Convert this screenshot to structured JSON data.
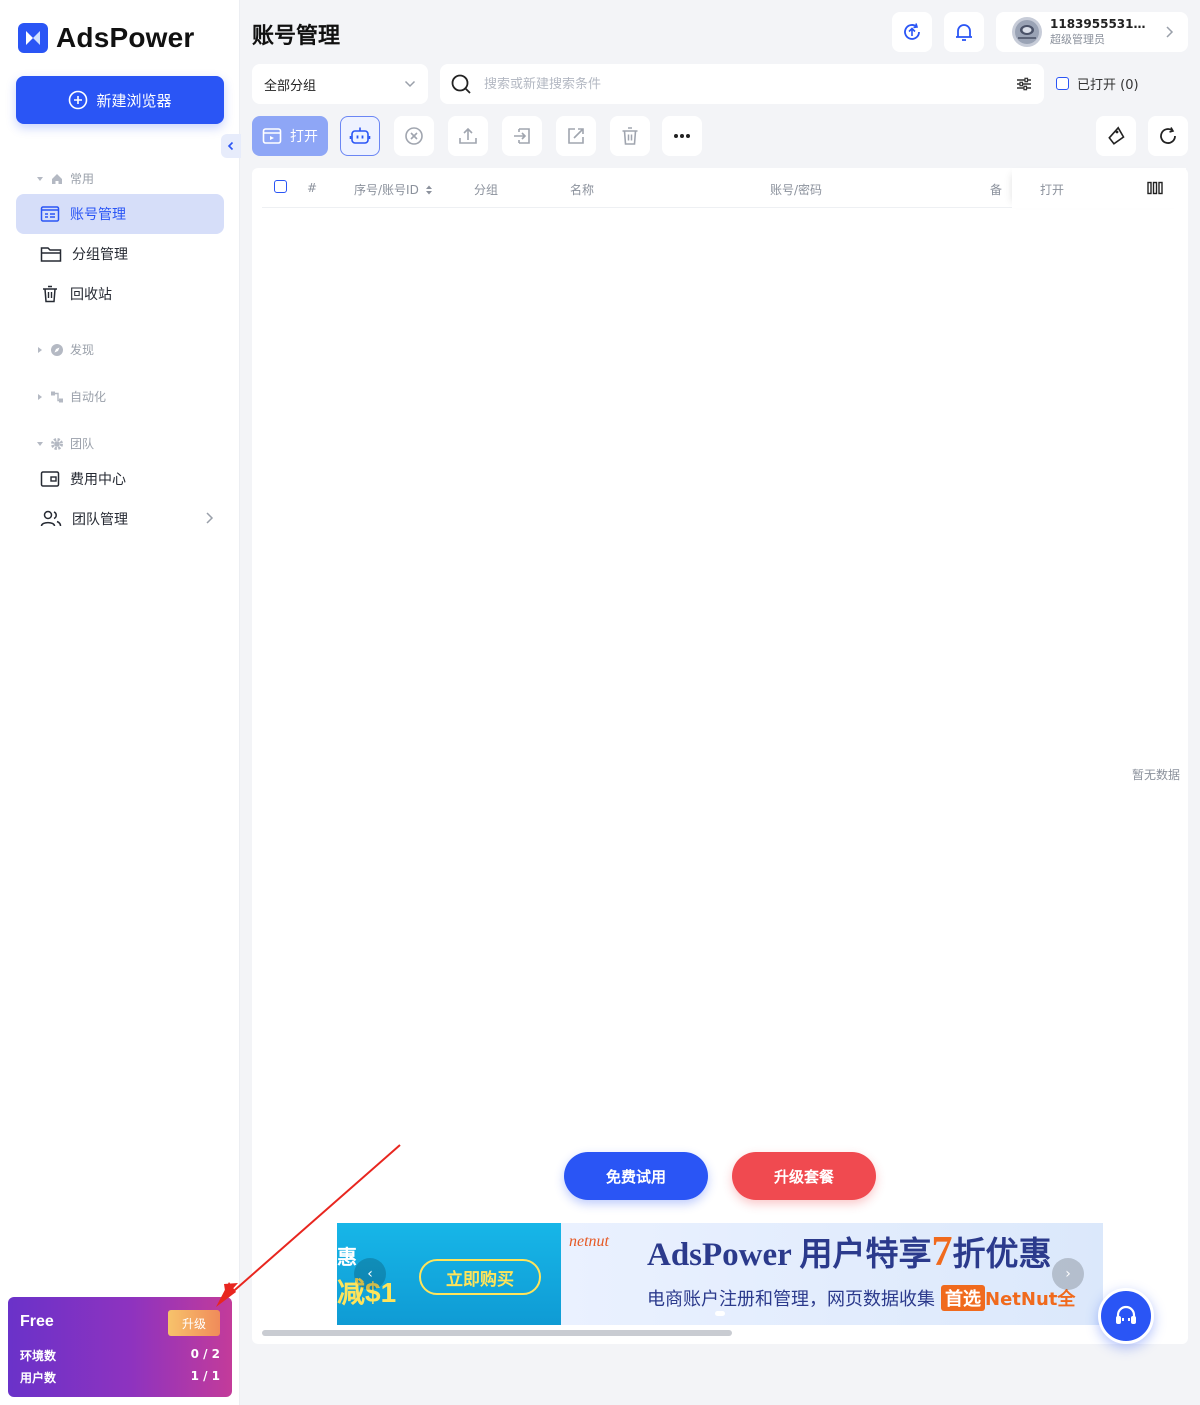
{
  "app": {
    "logo_text": "AdsPower",
    "new_browser_label": "新建浏览器"
  },
  "sidebar": {
    "sections": [
      {
        "label": "常用",
        "icon": "home-icon"
      },
      {
        "label": "发现",
        "icon": "compass-icon"
      },
      {
        "label": "自动化",
        "icon": "flow-icon"
      },
      {
        "label": "团队",
        "icon": "gear-icon"
      }
    ],
    "items": [
      {
        "label": "账号管理",
        "icon": "account-list-icon",
        "active": true
      },
      {
        "label": "分组管理",
        "icon": "folder-icon"
      },
      {
        "label": "回收站",
        "icon": "trash-icon"
      },
      {
        "label": "费用中心",
        "icon": "wallet-icon"
      },
      {
        "label": "团队管理",
        "icon": "users-icon"
      }
    ]
  },
  "plan": {
    "name": "Free",
    "upgrade_label": "升级",
    "env_label": "环境数",
    "env_value": "0 / 2",
    "user_label": "用户数",
    "user_value": "1 / 1"
  },
  "header": {
    "title": "账号管理",
    "user_name": "1183955531@...",
    "user_role": "超级管理员"
  },
  "filters": {
    "group_value": "全部分组",
    "search_placeholder": "搜索或新建搜索条件",
    "opened_label": "已打开 (0)"
  },
  "toolbar": {
    "open_label": "打开"
  },
  "table": {
    "columns": [
      "#",
      "序号/账号ID",
      "分组",
      "名称",
      "账号/密码",
      "备",
      "打开"
    ],
    "empty_text": "暂无数据"
  },
  "cta": {
    "trial_label": "免费试用",
    "upgrade_label": "升级套餐"
  },
  "banner": {
    "left_text_1": "惠",
    "left_text_2": "减$1",
    "buy_label": "立即购买",
    "partner_logo": "netnut",
    "title_prefix": "AdsPower 用户特享",
    "title_number": "7",
    "title_suffix": "折优惠",
    "subtitle": "电商账户注册和管理，网页数据收集",
    "subtitle_tag": "首选",
    "subtitle_brand": "NetNut全"
  },
  "colors": {
    "primary": "#2a55f5",
    "danger": "#f04a50",
    "plan_gradient_start": "#6a32c9",
    "plan_gradient_end": "#c33b9a"
  }
}
